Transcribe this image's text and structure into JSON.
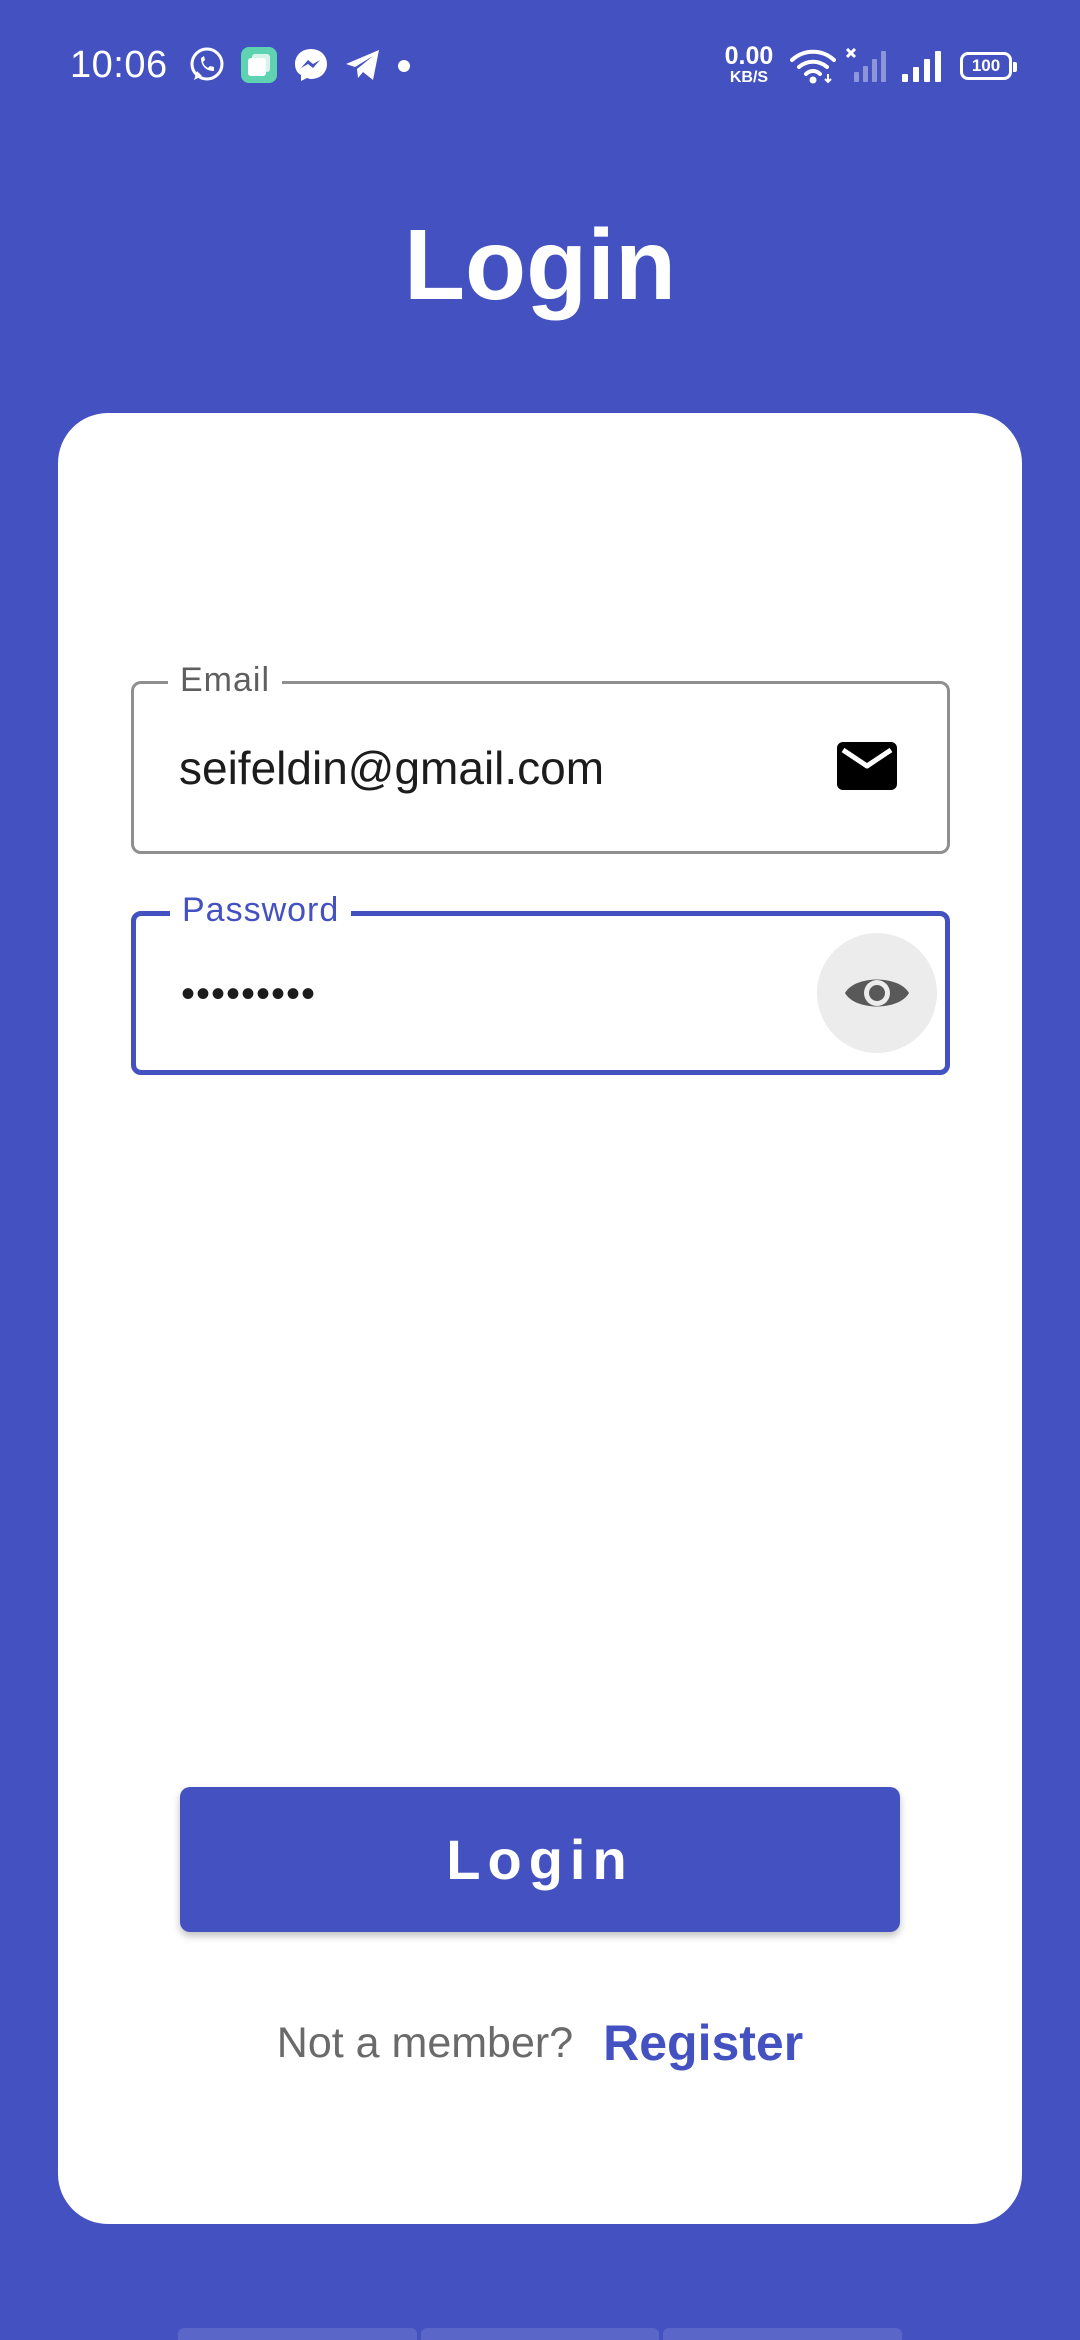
{
  "status_bar": {
    "time": "10:06",
    "net_speed_value": "0.00",
    "net_speed_unit": "KB/S",
    "battery": "100",
    "notification_icons": [
      "whatsapp-icon",
      "app-icon",
      "messenger-icon",
      "telegram-icon",
      "dot-icon"
    ],
    "system_icons": [
      "wifi-icon",
      "signal-no-service-icon",
      "signal-icon",
      "battery-icon"
    ]
  },
  "header": {
    "title": "Login"
  },
  "form": {
    "email": {
      "label": "Email",
      "value": "seifeldin@gmail.com",
      "icon": "mail-icon"
    },
    "password": {
      "label": "Password",
      "value": "•••••••••",
      "icon": "eye-icon",
      "focused": true
    },
    "submit_label": "Login"
  },
  "footer": {
    "prompt": "Not a member?",
    "link": "Register"
  },
  "colors": {
    "primary": "#4451c1",
    "card": "#ffffff",
    "field_border": "#8f8f8f",
    "muted_text": "#6a6a6a"
  }
}
